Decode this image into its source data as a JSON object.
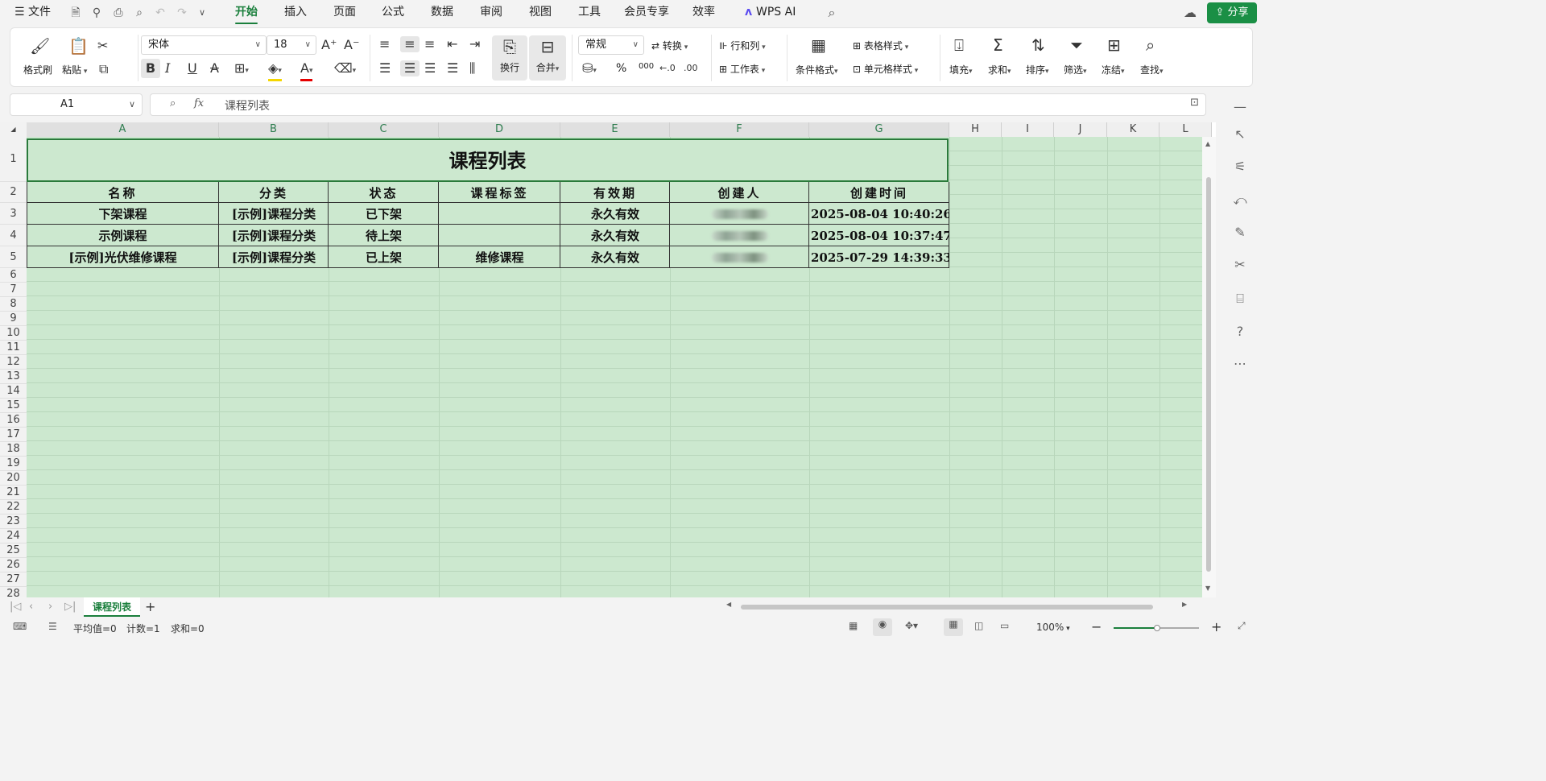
{
  "menu": {
    "file": "文件",
    "tabs": [
      "开始",
      "插入",
      "页面",
      "公式",
      "数据",
      "审阅",
      "视图",
      "工具",
      "会员专享",
      "效率"
    ],
    "active_tab": "开始",
    "wps_ai": "WPS AI",
    "share": "分享"
  },
  "ribbon": {
    "format_painter": "格式刷",
    "paste": "粘贴",
    "font_name": "宋体",
    "font_size": "18",
    "wrap": "换行",
    "merge": "合并",
    "number_format": "常规",
    "convert": "转换",
    "rows_cols": "行和列",
    "worksheet": "工作表",
    "cond_format": "条件格式",
    "table_style": "表格样式",
    "cell_style": "单元格样式",
    "fill": "填充",
    "sum": "求和",
    "sort": "排序",
    "filter": "筛选",
    "freeze": "冻结",
    "find": "查找",
    "percent": "%",
    "thousands": "000"
  },
  "formula_bar": {
    "name_box": "A1",
    "fx": "fx",
    "content": "课程列表"
  },
  "columns": [
    "A",
    "B",
    "C",
    "D",
    "E",
    "F",
    "G",
    "H",
    "I",
    "J",
    "K",
    "L"
  ],
  "rows": [
    "1",
    "2",
    "3",
    "4",
    "5",
    "6",
    "7",
    "8",
    "9",
    "10",
    "11",
    "12",
    "13",
    "14",
    "15",
    "16",
    "17",
    "18",
    "19",
    "20",
    "21",
    "22",
    "23",
    "24",
    "25",
    "26",
    "27",
    "28"
  ],
  "sheet": {
    "title": "课程列表",
    "headers": [
      "名称",
      "分类",
      "状态",
      "课程标签",
      "有效期",
      "创建人",
      "创建时间"
    ],
    "data": [
      [
        "下架课程",
        "[示例]课程分类",
        "已下架",
        "",
        "永久有效",
        "",
        "2025-08-04 10:40:26"
      ],
      [
        "示例课程",
        "[示例]课程分类",
        "待上架",
        "",
        "永久有效",
        "",
        "2025-08-04 10:37:47"
      ],
      [
        "[示例]光伏维修课程",
        "[示例]课程分类",
        "已上架",
        "维修课程",
        "永久有效",
        "",
        "2025-07-29 14:39:33"
      ]
    ]
  },
  "tabs_bar": {
    "sheet_tab": "课程列表",
    "add": "+"
  },
  "status": {
    "average": "平均值=0",
    "count": "计数=1",
    "sum": "求和=0",
    "zoom": "100%"
  },
  "colors": {
    "accent": "#1a7f3c",
    "cell_fill": "#cce8cf",
    "share_bg": "#1a8f45"
  }
}
